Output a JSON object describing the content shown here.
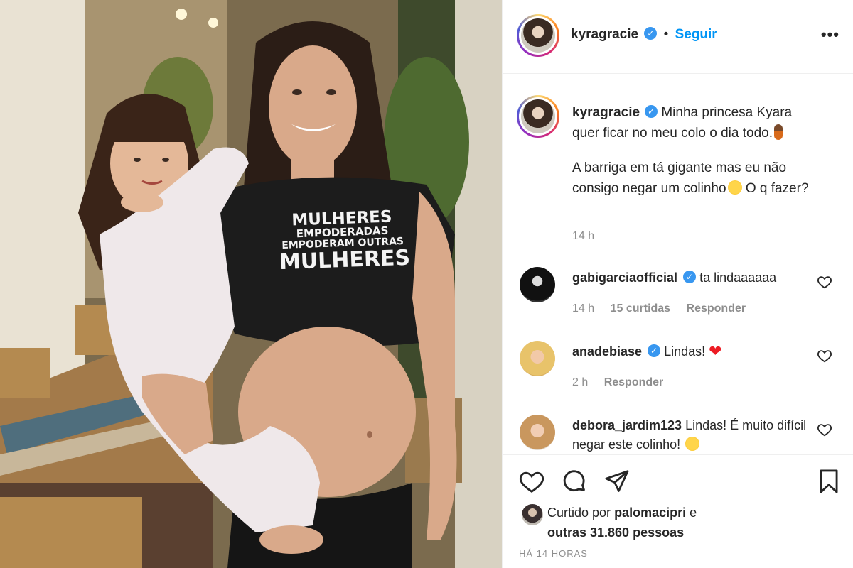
{
  "post": {
    "author": "kyragracie",
    "follow_label": "Seguir",
    "separator": "•",
    "more_label": "•••",
    "verified_mark": "✓"
  },
  "photo": {
    "shirt_lines": [
      "MULHERES",
      "EMPODERADAS",
      "EMPODERAM OUTRAS",
      "MULHERES"
    ]
  },
  "caption": {
    "username": "kyragracie",
    "line1": "Minha princesa Kyara quer ficar no meu colo o dia todo.",
    "line2": "A barriga em tá gigante mas eu não consigo negar um colinho",
    "line2_end": "O q fazer?",
    "time": "14 h"
  },
  "comments": [
    {
      "username": "gabigarciaofficial",
      "verified": true,
      "text": "ta lindaaaaaa",
      "time": "14 h",
      "likes": "15 curtidas",
      "reply": "Responder"
    },
    {
      "username": "anadebiase",
      "verified": true,
      "text": "Lindas!",
      "time": "2 h",
      "reply": "Responder"
    },
    {
      "username": "debora_jardim123",
      "verified": false,
      "text": "Lindas! É muito difícil negar este colinho!"
    }
  ],
  "likes": {
    "prefix": "Curtido por",
    "user": "palomacipri",
    "connector": "e",
    "others": "outras 31.860 pessoas"
  },
  "posted_ago": "HÁ 14 HORAS",
  "icons": [
    "heart-icon",
    "comment-icon",
    "share-icon",
    "bookmark-icon",
    "more-icon",
    "verified-icon"
  ],
  "colors": {
    "accent": "#0095f6",
    "verified": "#3897f0",
    "muted": "#8e8e8e",
    "text": "#262626"
  }
}
